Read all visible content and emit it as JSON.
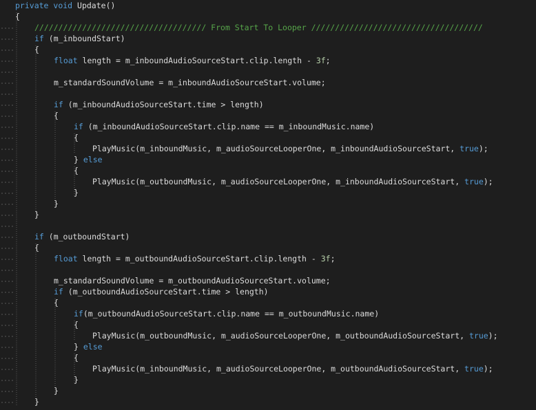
{
  "editor": {
    "colors": {
      "background": "#1e1e1e",
      "text": "#dcdcdc",
      "keyword": "#569cd6",
      "comment": "#57a64a",
      "number": "#b5cea8",
      "guide": "#5a5a5a"
    },
    "lines": [
      [
        {
          "t": "kw",
          "v": "private"
        },
        {
          "t": "plain",
          "v": " "
        },
        {
          "t": "kw",
          "v": "void"
        },
        {
          "t": "plain",
          "v": " Update()"
        }
      ],
      [
        {
          "t": "plain",
          "v": "{"
        }
      ],
      [
        {
          "t": "cmt",
          "v": "//////////////////////////////////// From Start To Looper ////////////////////////////////////"
        }
      ],
      [
        {
          "t": "kw",
          "v": "if"
        },
        {
          "t": "plain",
          "v": " (m_inboundStart)"
        }
      ],
      [
        {
          "t": "plain",
          "v": "{"
        }
      ],
      [
        {
          "t": "kw",
          "v": "float"
        },
        {
          "t": "plain",
          "v": " length = m_inboundAudioSourceStart.clip.length - "
        },
        {
          "t": "num",
          "v": "3f"
        },
        {
          "t": "plain",
          "v": ";"
        }
      ],
      [],
      [
        {
          "t": "plain",
          "v": "m_standardSoundVolume = m_inboundAudioSourceStart.volume;"
        }
      ],
      [],
      [
        {
          "t": "kw",
          "v": "if"
        },
        {
          "t": "plain",
          "v": " (m_inboundAudioSourceStart.time > length)"
        }
      ],
      [
        {
          "t": "plain",
          "v": "{"
        }
      ],
      [
        {
          "t": "kw",
          "v": "if"
        },
        {
          "t": "plain",
          "v": " (m_inboundAudioSourceStart.clip.name == m_inboundMusic.name)"
        }
      ],
      [
        {
          "t": "plain",
          "v": "{"
        }
      ],
      [
        {
          "t": "plain",
          "v": "PlayMusic(m_inboundMusic, m_audioSourceLooperOne, m_inboundAudioSourceStart, "
        },
        {
          "t": "kw",
          "v": "true"
        },
        {
          "t": "plain",
          "v": ");"
        }
      ],
      [
        {
          "t": "plain",
          "v": "} "
        },
        {
          "t": "kw",
          "v": "else"
        }
      ],
      [
        {
          "t": "plain",
          "v": "{"
        }
      ],
      [
        {
          "t": "plain",
          "v": "PlayMusic(m_outboundMusic, m_audioSourceLooperOne, m_inboundAudioSourceStart, "
        },
        {
          "t": "kw",
          "v": "true"
        },
        {
          "t": "plain",
          "v": ");"
        }
      ],
      [
        {
          "t": "plain",
          "v": "}"
        }
      ],
      [
        {
          "t": "plain",
          "v": "}"
        }
      ],
      [
        {
          "t": "plain",
          "v": "}"
        }
      ],
      [],
      [
        {
          "t": "kw",
          "v": "if"
        },
        {
          "t": "plain",
          "v": " (m_outboundStart)"
        }
      ],
      [
        {
          "t": "plain",
          "v": "{"
        }
      ],
      [
        {
          "t": "kw",
          "v": "float"
        },
        {
          "t": "plain",
          "v": " length = m_outboundAudioSourceStart.clip.length - "
        },
        {
          "t": "num",
          "v": "3f"
        },
        {
          "t": "plain",
          "v": ";"
        }
      ],
      [],
      [
        {
          "t": "plain",
          "v": "m_standardSoundVolume = m_outboundAudioSourceStart.volume;"
        }
      ],
      [
        {
          "t": "kw",
          "v": "if"
        },
        {
          "t": "plain",
          "v": " (m_outboundAudioSourceStart.time > length)"
        }
      ],
      [
        {
          "t": "plain",
          "v": "{"
        }
      ],
      [
        {
          "t": "kw",
          "v": "if"
        },
        {
          "t": "plain",
          "v": "(m_outboundAudioSourceStart.clip.name == m_outboundMusic.name)"
        }
      ],
      [
        {
          "t": "plain",
          "v": "{"
        }
      ],
      [
        {
          "t": "plain",
          "v": "PlayMusic(m_outboundMusic, m_audioSourceLooperOne, m_outboundAudioSourceStart, "
        },
        {
          "t": "kw",
          "v": "true"
        },
        {
          "t": "plain",
          "v": ");"
        }
      ],
      [
        {
          "t": "plain",
          "v": "} "
        },
        {
          "t": "kw",
          "v": "else"
        }
      ],
      [
        {
          "t": "plain",
          "v": "{"
        }
      ],
      [
        {
          "t": "plain",
          "v": "PlayMusic(m_inboundMusic, m_audioSourceLooperOne, m_outboundAudioSourceStart, "
        },
        {
          "t": "kw",
          "v": "true"
        },
        {
          "t": "plain",
          "v": ");"
        }
      ],
      [
        {
          "t": "plain",
          "v": "}"
        }
      ],
      [
        {
          "t": "plain",
          "v": "}"
        }
      ],
      [
        {
          "t": "plain",
          "v": "}"
        }
      ]
    ]
  }
}
